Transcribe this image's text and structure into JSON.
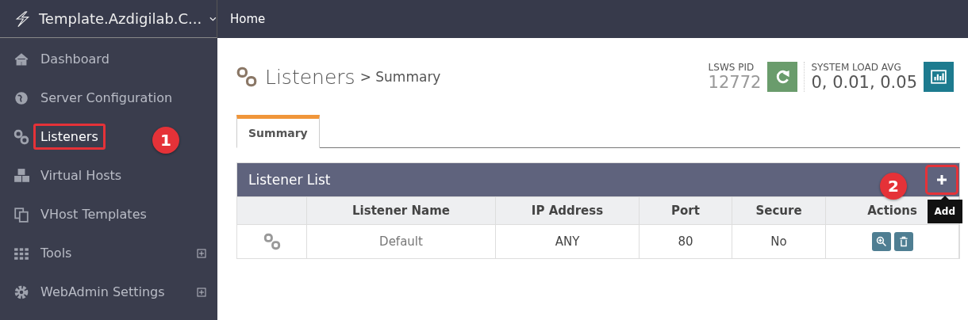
{
  "header": {
    "server_name": "Template.Azdigilab.C...",
    "breadcrumb": "Home"
  },
  "sidebar": {
    "items": [
      {
        "label": "Dashboard",
        "expandable": false,
        "highlighted": false
      },
      {
        "label": "Server Configuration",
        "expandable": false,
        "highlighted": false
      },
      {
        "label": "Listeners",
        "expandable": false,
        "highlighted": true,
        "callout": "1"
      },
      {
        "label": "Virtual Hosts",
        "expandable": false,
        "highlighted": false
      },
      {
        "label": "VHost Templates",
        "expandable": false,
        "highlighted": false
      },
      {
        "label": "Tools",
        "expandable": true,
        "highlighted": false
      },
      {
        "label": "WebAdmin Settings",
        "expandable": true,
        "highlighted": false
      }
    ]
  },
  "page": {
    "title": "Listeners",
    "subtitle": "> Summary"
  },
  "stats": [
    {
      "label": "LSWS PID",
      "value": "12772",
      "kind": "pid"
    },
    {
      "label": "SYSTEM LOAD AVG",
      "value": "0, 0.01, 0.05",
      "kind": "load"
    }
  ],
  "tabs": [
    {
      "label": "Summary",
      "selected": true
    }
  ],
  "table": {
    "title": "Listener List",
    "add_button": {
      "tooltip": "Add",
      "highlighted": true,
      "callout": "2"
    },
    "columns": [
      "Listener Name",
      "IP Address",
      "Port",
      "Secure",
      "Actions"
    ],
    "rows": [
      {
        "cells": [
          "Default",
          "ANY",
          "80",
          "No"
        ]
      }
    ]
  }
}
